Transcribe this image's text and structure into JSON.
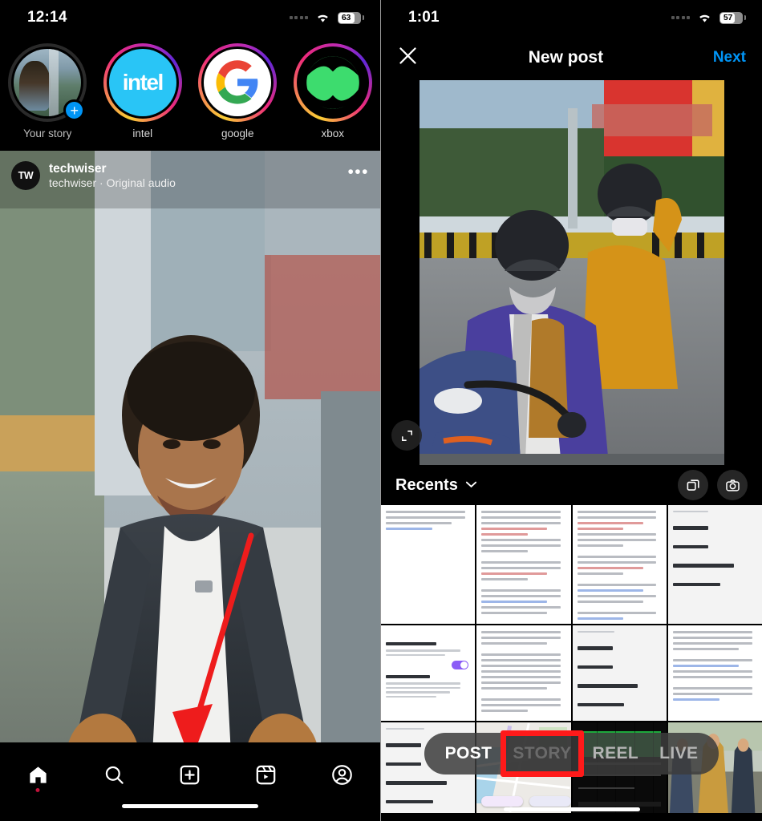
{
  "left_phone": {
    "status": {
      "time": "12:14",
      "battery": "63",
      "wifi_icon": "wifi-icon",
      "signal_icon": "cellular-dots-icon"
    },
    "stories": {
      "items": [
        {
          "label": "Your story",
          "type": "your-story",
          "has_add_badge": true,
          "badge": "+"
        },
        {
          "label": "intel",
          "type": "brand",
          "logo_text": "intel",
          "brand_color": "#29c5f6"
        },
        {
          "label": "google",
          "type": "brand",
          "logo_text": "G",
          "brand_color": "#ffffff"
        },
        {
          "label": "xbox",
          "type": "brand",
          "logo_text": "xbox",
          "brand_color": "#107c10"
        }
      ]
    },
    "post": {
      "avatar_initials": "TW",
      "username": "techwiser",
      "audio_line": "techwiser · Original audio",
      "more_icon": "ellipsis-icon",
      "mute_icon": "speaker-muted-icon"
    },
    "tabbar": {
      "items": [
        {
          "name": "home",
          "icon": "home-icon",
          "active": true,
          "has_dot": true
        },
        {
          "name": "search",
          "icon": "search-icon",
          "active": false,
          "has_dot": false
        },
        {
          "name": "create",
          "icon": "plus-square-icon",
          "active": false,
          "has_dot": false
        },
        {
          "name": "reels",
          "icon": "reels-icon",
          "active": false,
          "has_dot": false
        },
        {
          "name": "profile",
          "icon": "profile-circle-icon",
          "active": false,
          "has_dot": false
        }
      ]
    },
    "annotation": {
      "type": "arrow",
      "color": "#ff1a1a",
      "points_to": "create-tab"
    }
  },
  "right_phone": {
    "status": {
      "time": "1:01",
      "battery": "57",
      "wifi_icon": "wifi-icon",
      "signal_icon": "cellular-dots-icon"
    },
    "navbar": {
      "close_icon": "close-x-icon",
      "title": "New post",
      "next_label": "Next",
      "next_color": "#0095f6"
    },
    "preview": {
      "expand_icon": "expand-crop-icon"
    },
    "gallery": {
      "album_label": "Recents",
      "chevron_icon": "chevron-down-icon",
      "multi_select_icon": "multi-select-icon",
      "camera_icon": "camera-icon",
      "thumbnails": [
        {
          "kind": "document"
        },
        {
          "kind": "document"
        },
        {
          "kind": "document"
        },
        {
          "kind": "document-menu"
        },
        {
          "kind": "document-settings"
        },
        {
          "kind": "document"
        },
        {
          "kind": "document-menu"
        },
        {
          "kind": "document"
        },
        {
          "kind": "document-menu"
        },
        {
          "kind": "map"
        },
        {
          "kind": "dark-app"
        },
        {
          "kind": "photo-people"
        },
        {
          "kind": "interior"
        },
        {
          "kind": "interior-light"
        },
        {
          "kind": "concert"
        },
        {
          "kind": "dark-room"
        }
      ]
    },
    "mode_selector": {
      "options": [
        "POST",
        "STORY",
        "REEL",
        "LIVE"
      ],
      "selected": "POST",
      "highlighted": "STORY",
      "highlight_color": "#ff1a1a"
    }
  }
}
